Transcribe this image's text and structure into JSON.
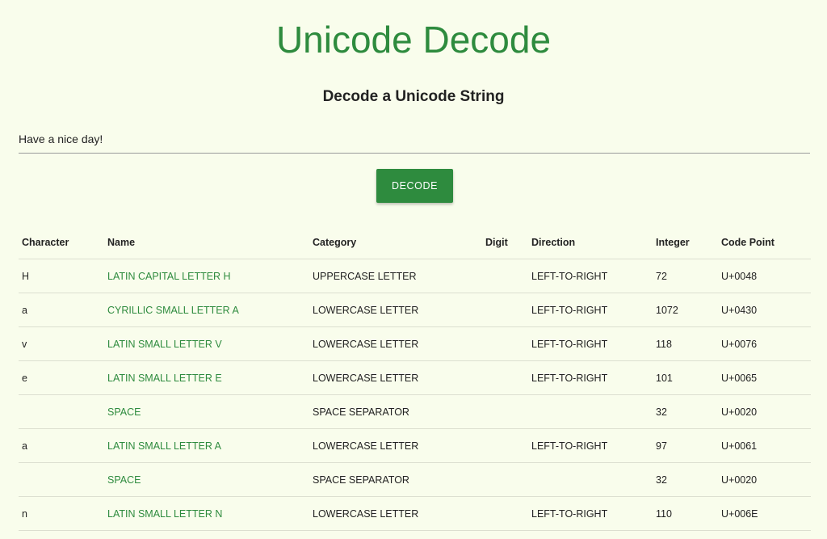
{
  "header": {
    "title": "Unicode Decode",
    "subtitle": "Decode a Unicode String"
  },
  "form": {
    "input_value": "Have a nice day!",
    "button_label": "DECODE"
  },
  "table": {
    "columns": [
      "Character",
      "Name",
      "Category",
      "Digit",
      "Direction",
      "Integer",
      "Code Point"
    ],
    "rows": [
      {
        "character": "H",
        "name": "LATIN CAPITAL LETTER H",
        "category": "UPPERCASE LETTER",
        "digit": "",
        "direction": "LEFT-TO-RIGHT",
        "integer": "72",
        "code_point": "U+0048"
      },
      {
        "character": "a",
        "name": "CYRILLIC SMALL LETTER A",
        "category": "LOWERCASE LETTER",
        "digit": "",
        "direction": "LEFT-TO-RIGHT",
        "integer": "1072",
        "code_point": "U+0430"
      },
      {
        "character": "v",
        "name": "LATIN SMALL LETTER V",
        "category": "LOWERCASE LETTER",
        "digit": "",
        "direction": "LEFT-TO-RIGHT",
        "integer": "118",
        "code_point": "U+0076"
      },
      {
        "character": "e",
        "name": "LATIN SMALL LETTER E",
        "category": "LOWERCASE LETTER",
        "digit": "",
        "direction": "LEFT-TO-RIGHT",
        "integer": "101",
        "code_point": "U+0065"
      },
      {
        "character": "",
        "name": "SPACE",
        "category": "SPACE SEPARATOR",
        "digit": "",
        "direction": "",
        "integer": "32",
        "code_point": "U+0020"
      },
      {
        "character": "a",
        "name": "LATIN SMALL LETTER A",
        "category": "LOWERCASE LETTER",
        "digit": "",
        "direction": "LEFT-TO-RIGHT",
        "integer": "97",
        "code_point": "U+0061"
      },
      {
        "character": "",
        "name": "SPACE",
        "category": "SPACE SEPARATOR",
        "digit": "",
        "direction": "",
        "integer": "32",
        "code_point": "U+0020"
      },
      {
        "character": "n",
        "name": "LATIN SMALL LETTER N",
        "category": "LOWERCASE LETTER",
        "digit": "",
        "direction": "LEFT-TO-RIGHT",
        "integer": "110",
        "code_point": "U+006E"
      }
    ]
  },
  "colors": {
    "background": "#f9fdec",
    "accent": "#2e8b3e",
    "button_text": "#ffffff"
  }
}
